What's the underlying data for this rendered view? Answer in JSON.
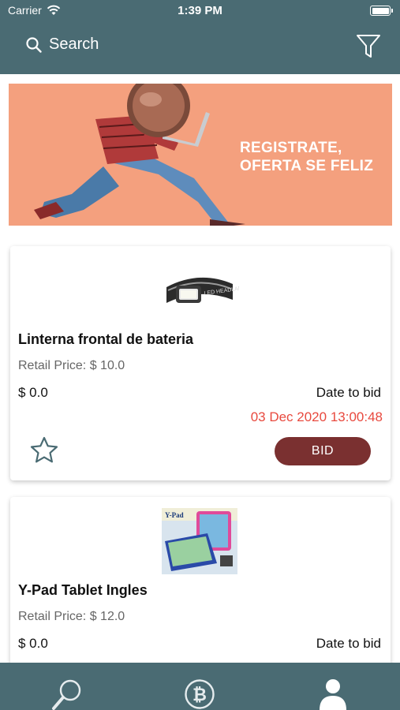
{
  "status_bar": {
    "carrier": "Carrier",
    "time": "1:39 PM"
  },
  "header": {
    "search_label": "Search"
  },
  "banner": {
    "line1": "REGISTRATE,",
    "line2": "OFERTA SE FELIZ"
  },
  "products": [
    {
      "title": "Linterna frontal de bateria",
      "retail_price": "Retail Price: $ 10.0",
      "current_price": "$ 0.0",
      "date_label": "Date to bid",
      "date_value": "03 Dec 2020 13:00:48",
      "bid_label": "BID"
    },
    {
      "title": "Y-Pad Tablet Ingles",
      "retail_price": "Retail Price: $ 12.0",
      "current_price": "$ 0.0",
      "date_label": "Date to bid"
    }
  ],
  "headlamp_text": "LED HEADLAMP",
  "tablet_text": "Y-Pad",
  "colors": {
    "primary": "#4a6b73",
    "bid_button": "#7a3030",
    "date_red": "#e8493e",
    "banner_bg": "#f4a07e"
  },
  "tabbar": {
    "icons": [
      "search-icon",
      "bitcoin-icon",
      "profile-icon"
    ]
  }
}
